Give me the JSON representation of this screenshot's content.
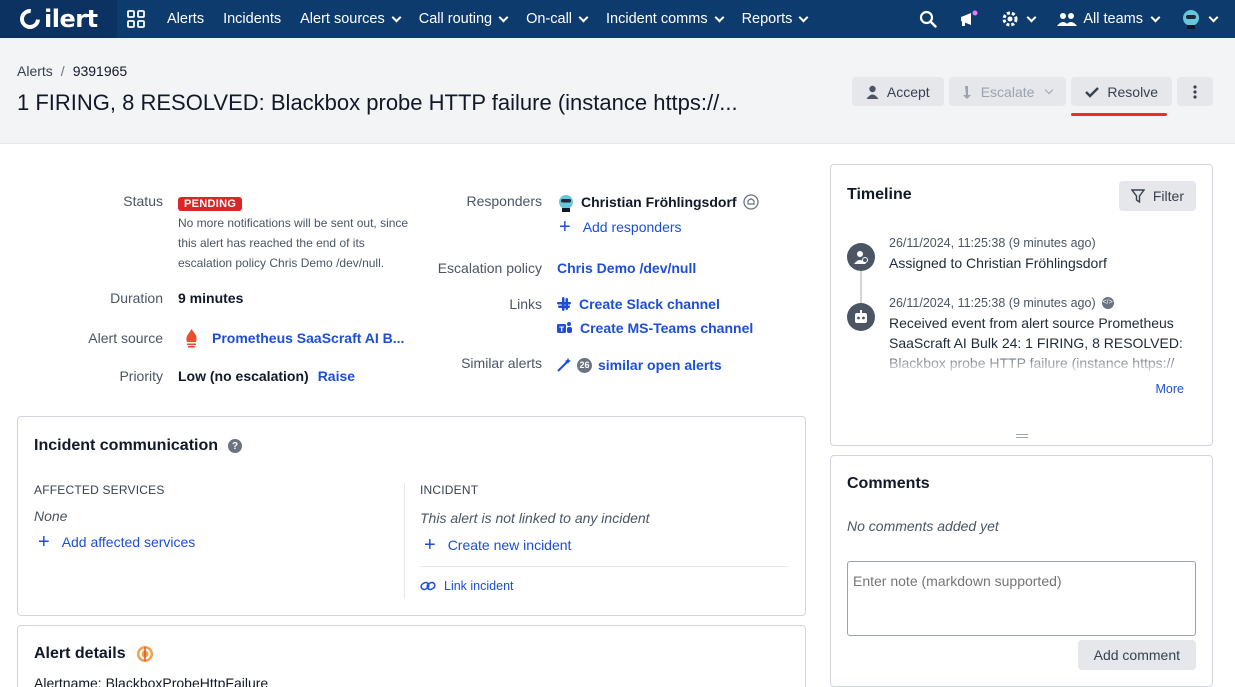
{
  "nav": {
    "logo": "ilert",
    "items": [
      {
        "label": "Alerts",
        "dropdown": false
      },
      {
        "label": "Incidents",
        "dropdown": false
      },
      {
        "label": "Alert sources",
        "dropdown": true
      },
      {
        "label": "Call routing",
        "dropdown": true
      },
      {
        "label": "On-call",
        "dropdown": true
      },
      {
        "label": "Incident comms",
        "dropdown": true
      },
      {
        "label": "Reports",
        "dropdown": true
      }
    ],
    "teams_label": "All teams"
  },
  "header": {
    "breadcrumb_root": "Alerts",
    "breadcrumb_sep": "/",
    "breadcrumb_id": "9391965",
    "title": "1 FIRING, 8 RESOLVED: Blackbox probe HTTP failure (instance https://...",
    "accept_label": "Accept",
    "escalate_label": "Escalate",
    "resolve_label": "Resolve"
  },
  "details": {
    "status_label": "Status",
    "status_badge": "PENDING",
    "status_note": "No more notifications will be sent out, since this alert has reached the end of its escalation policy Chris Demo /dev/null.",
    "duration_label": "Duration",
    "duration_value": "9 minutes",
    "source_label": "Alert source",
    "source_value": "Prometheus SaaScraft AI B...",
    "priority_label": "Priority",
    "priority_value": "Low (no escalation)",
    "priority_action": "Raise",
    "responders_label": "Responders",
    "responder_name": "Christian Fröhlingsdorf",
    "add_responders": "Add responders",
    "escalation_label": "Escalation policy",
    "escalation_value": "Chris Demo /dev/null",
    "links_label": "Links",
    "slack_link": "Create Slack channel",
    "teams_link": "Create MS-Teams channel",
    "similar_label": "Similar alerts",
    "similar_count": "26",
    "similar_link": "similar open alerts"
  },
  "incident_comm": {
    "title": "Incident communication",
    "affected_header": "AFFECTED SERVICES",
    "affected_value": "None",
    "add_affected": "Add affected services",
    "incident_header": "INCIDENT",
    "incident_note": "This alert is not linked to any incident",
    "create_incident": "Create new incident",
    "link_incident": "Link incident"
  },
  "alert_details": {
    "title": "Alert details",
    "first_line": "Alertname: BlackboxProbeHttpFailure"
  },
  "timeline": {
    "title": "Timeline",
    "filter_label": "Filter",
    "events": [
      {
        "date": "26/11/2024, 11:25:38 (9 minutes ago)",
        "text": "Assigned to Christian Fröhlingsdorf"
      },
      {
        "date": "26/11/2024, 11:25:38 (9 minutes ago)",
        "text": "Received event from alert source Prometheus SaaScraft AI Bulk 24: 1 FIRING, 8 RESOLVED: Blackbox probe HTTP failure (instance https://"
      }
    ],
    "more_label": "More"
  },
  "comments": {
    "title": "Comments",
    "empty_text": "No comments added yet",
    "placeholder": "Enter note (markdown supported)",
    "add_label": "Add comment"
  },
  "colors": {
    "nav_bg": "#0e3b6e",
    "link": "#1d4ed8",
    "badge": "#dc2626",
    "highlight": "#ef2d22"
  }
}
